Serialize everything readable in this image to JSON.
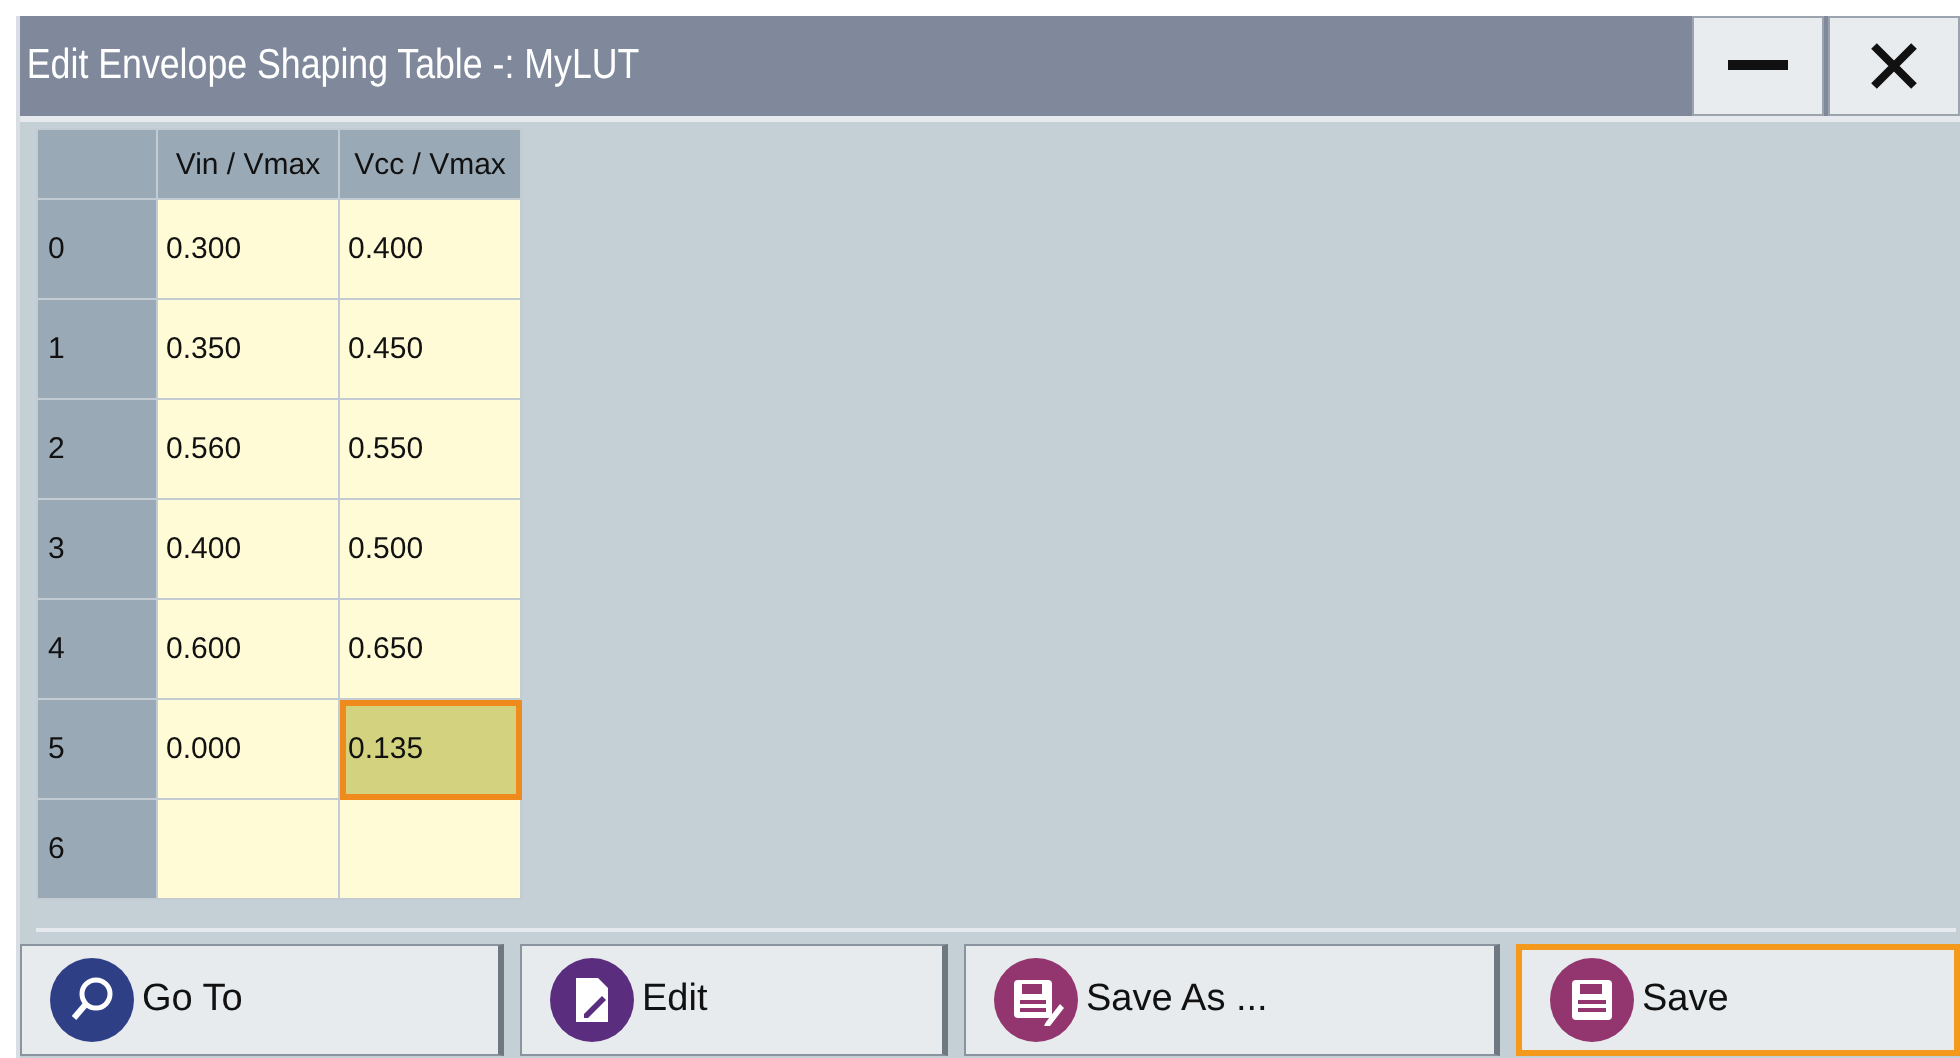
{
  "window": {
    "title": "Edit Envelope Shaping Table -: MyLUT",
    "controls": [
      {
        "kind": "minimize"
      },
      {
        "kind": "close"
      }
    ]
  },
  "table": {
    "columns": [
      "Vin / Vmax",
      "Vcc / Vmax"
    ],
    "rows": [
      {
        "index": "0",
        "cells": [
          {
            "value": "0.300",
            "selected": false
          },
          {
            "value": "0.400",
            "selected": false
          }
        ]
      },
      {
        "index": "1",
        "cells": [
          {
            "value": "0.350",
            "selected": false
          },
          {
            "value": "0.450",
            "selected": false
          }
        ]
      },
      {
        "index": "2",
        "cells": [
          {
            "value": "0.560",
            "selected": false
          },
          {
            "value": "0.550",
            "selected": false
          }
        ]
      },
      {
        "index": "3",
        "cells": [
          {
            "value": "0.400",
            "selected": false
          },
          {
            "value": "0.500",
            "selected": false
          }
        ]
      },
      {
        "index": "4",
        "cells": [
          {
            "value": "0.600",
            "selected": false
          },
          {
            "value": "0.650",
            "selected": false
          }
        ]
      },
      {
        "index": "5",
        "cells": [
          {
            "value": "0.000",
            "selected": false
          },
          {
            "value": "0.135",
            "selected": true
          }
        ]
      },
      {
        "index": "6",
        "cells": [
          {
            "selected": false
          },
          {
            "selected": false
          }
        ]
      }
    ]
  },
  "buttons": [
    {
      "label": "Go To",
      "kind": "search",
      "focused": false
    },
    {
      "label": "Edit",
      "kind": "edit",
      "focused": false
    },
    {
      "label": "Save As ...",
      "kind": "save-as",
      "focused": false
    },
    {
      "label": "Save",
      "kind": "save",
      "focused": true
    }
  ]
}
